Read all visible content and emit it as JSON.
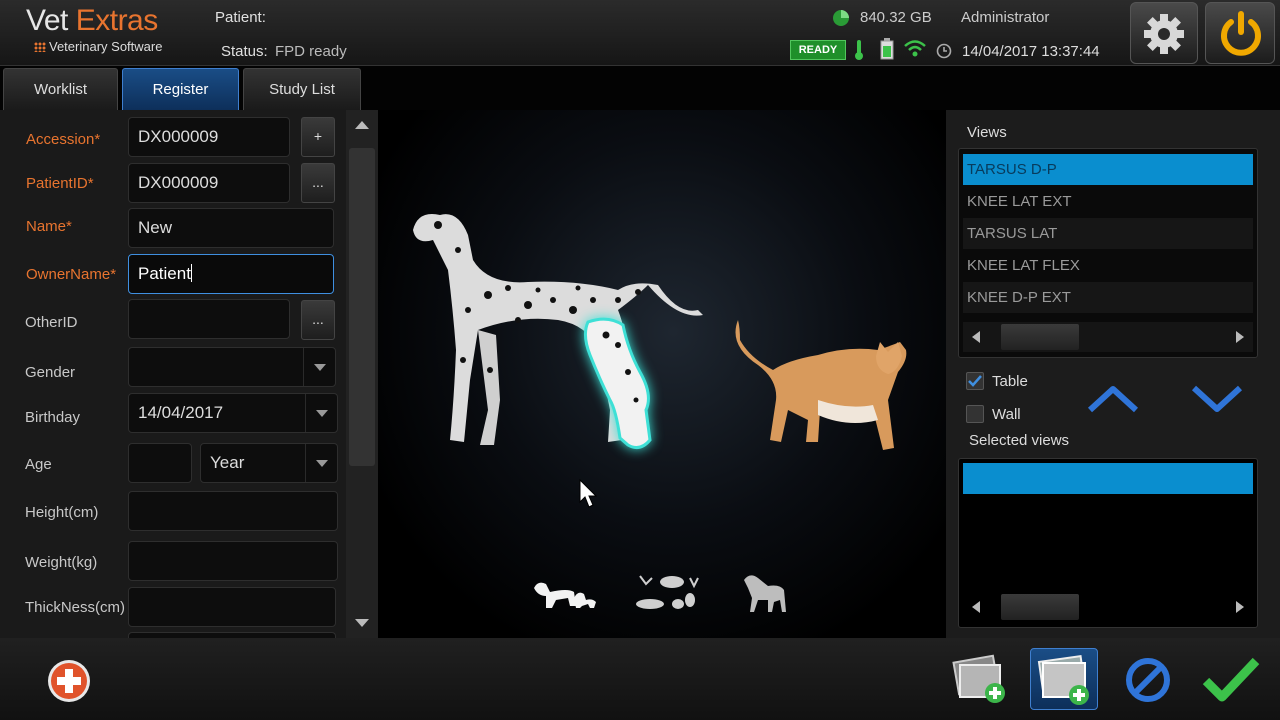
{
  "app": {
    "name_main": "Vet ",
    "name_accent": "Extras",
    "subtitle": "Veterinary Software"
  },
  "header": {
    "patient_label": "Patient:",
    "patient_value": "",
    "status_label": "Status:",
    "status_value": "FPD ready",
    "disk_free": "840.32 GB",
    "user": "Administrator",
    "ready_badge": "READY",
    "datetime": "14/04/2017 13:37:44"
  },
  "tabs": [
    {
      "label": "Worklist",
      "active": false
    },
    {
      "label": "Register",
      "active": true
    },
    {
      "label": "Study List",
      "active": false
    }
  ],
  "form": {
    "accession": {
      "label": "Accession*",
      "value": "DX000009",
      "button": "+"
    },
    "patient_id": {
      "label": "PatientID*",
      "value": "DX000009",
      "button": "..."
    },
    "name": {
      "label": "Name*",
      "value": "New"
    },
    "owner_name": {
      "label": "OwnerName*",
      "value": "Patient"
    },
    "other_id": {
      "label": "OtherID",
      "value": "",
      "button": "..."
    },
    "gender": {
      "label": "Gender",
      "value": ""
    },
    "birthday": {
      "label": "Birthday",
      "value": "14/04/2017"
    },
    "age": {
      "label": "Age",
      "value": "",
      "unit": "Year"
    },
    "height": {
      "label": "Height(cm)",
      "value": ""
    },
    "weight": {
      "label": "Weight(kg)",
      "value": ""
    },
    "thickness": {
      "label": "ThickNess(cm)",
      "value": ""
    }
  },
  "views_panel": {
    "title": "Views",
    "items": [
      "TARSUS D-P",
      "KNEE LAT EXT",
      "TARSUS LAT",
      "KNEE LAT FLEX",
      "KNEE D-P EXT"
    ],
    "selected_index": 0,
    "table_label": "Table",
    "table_checked": true,
    "wall_label": "Wall",
    "wall_checked": false,
    "selected_views_title": "Selected views",
    "selected_views": [
      ""
    ]
  },
  "anatomy": {
    "highlighted_region": "dog-hind-leg",
    "species": [
      "dog-and-cat",
      "exotic-animals",
      "horse"
    ]
  },
  "colors": {
    "accent_orange": "#e8742f",
    "selection_blue": "#0a8ecf",
    "ready_green": "#1f8f2a",
    "highlight_cyan": "#3ee0d6"
  },
  "icons": [
    "gear-icon",
    "power-icon",
    "disk-icon",
    "thermometer-icon",
    "battery-icon",
    "wifi-icon",
    "clock-icon",
    "add-patient-icon",
    "add-image-icon",
    "add-study-icon",
    "cancel-icon",
    "confirm-icon",
    "chevron-up-icon",
    "chevron-down-icon"
  ]
}
